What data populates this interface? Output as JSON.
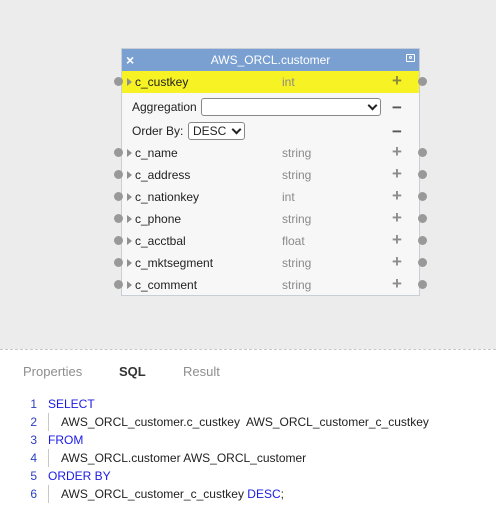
{
  "table": {
    "title": "AWS_ORCL.customer",
    "close_glyph": "×",
    "selected_column": {
      "name": "c_custkey",
      "type": "int"
    },
    "options": {
      "aggregation_label": "Aggregation",
      "aggregation_value": "",
      "order_by_label": "Order By:",
      "order_by_value": "DESC"
    },
    "columns": [
      {
        "name": "c_name",
        "type": "string"
      },
      {
        "name": "c_address",
        "type": "string"
      },
      {
        "name": "c_nationkey",
        "type": "int"
      },
      {
        "name": "c_phone",
        "type": "string"
      },
      {
        "name": "c_acctbal",
        "type": "float"
      },
      {
        "name": "c_mktsegment",
        "type": "string"
      },
      {
        "name": "c_comment",
        "type": "string"
      }
    ],
    "highlight_color": "#f7f224",
    "header_color": "#7a9fd1"
  },
  "tabs": [
    {
      "label": "Properties",
      "active": false
    },
    {
      "label": "SQL",
      "active": true
    },
    {
      "label": "Result",
      "active": false
    }
  ],
  "sql": {
    "lines": [
      {
        "num": "1",
        "text": "SELECT"
      },
      {
        "num": "2",
        "text": "AWS_ORCL_customer.c_custkey  AWS_ORCL_customer_c_custkey"
      },
      {
        "num": "3",
        "text": "FROM"
      },
      {
        "num": "4",
        "text": "AWS_ORCL.customer AWS_ORCL_customer"
      },
      {
        "num": "5",
        "text": "ORDER BY"
      },
      {
        "num": "6",
        "text": "AWS_ORCL_customer_c_custkey ",
        "keyword": "DESC",
        "tail": ";"
      }
    ]
  }
}
